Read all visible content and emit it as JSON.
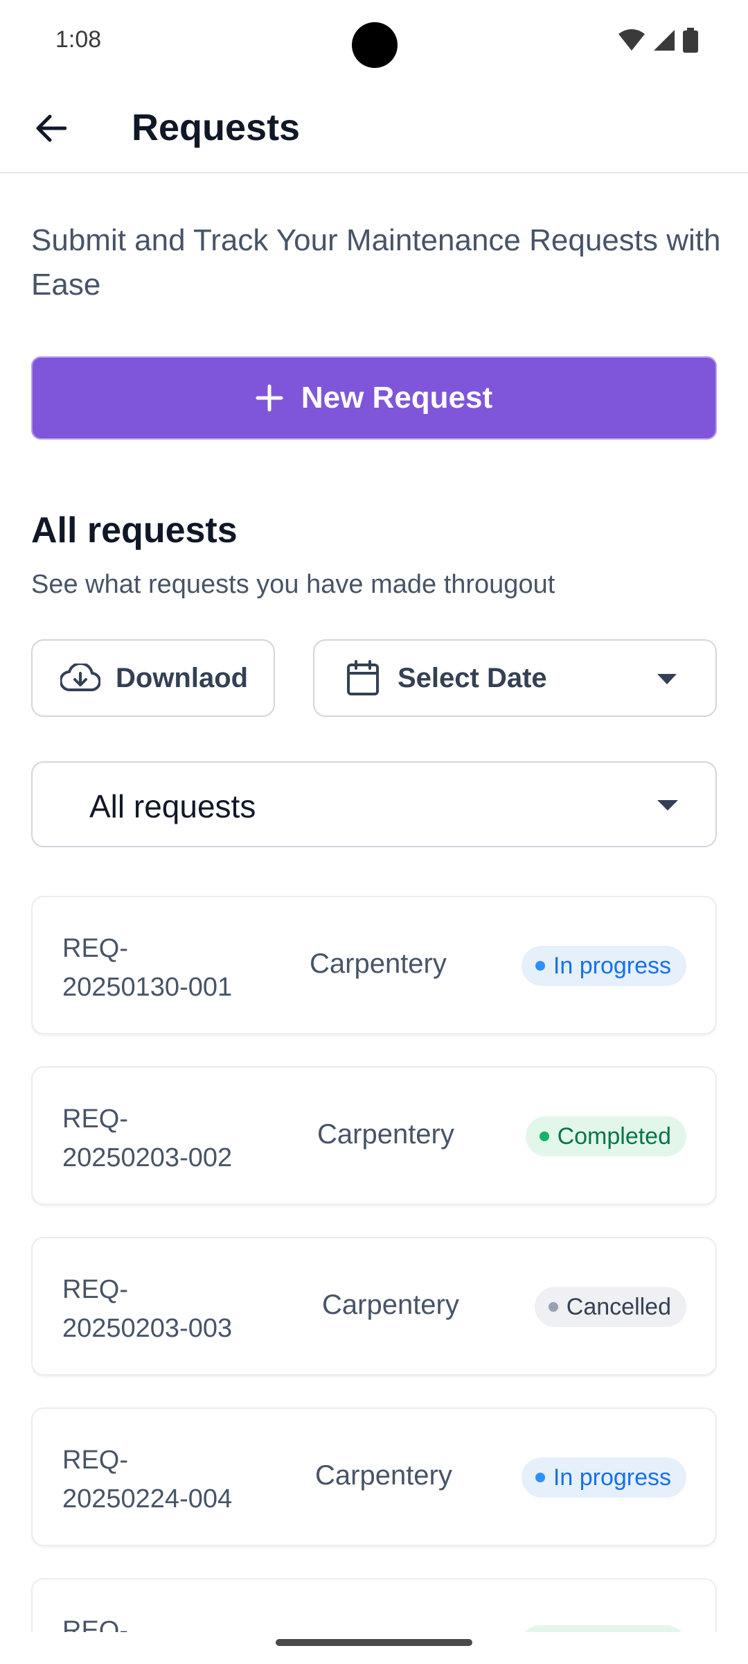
{
  "status_bar": {
    "time": "1:08"
  },
  "app_bar": {
    "title": "Requests"
  },
  "intro": {
    "subtitle": "Submit and Track Your Maintenance Requests with Ease"
  },
  "new_request": {
    "label": "New Request"
  },
  "section": {
    "title": "All requests",
    "subtitle": "See what requests you have made througout"
  },
  "toolbar": {
    "download_label": "Downlaod",
    "date_label": "Select Date"
  },
  "filter": {
    "selected": "All requests"
  },
  "requests": [
    {
      "id_prefix": "REQ-",
      "id_number": "20250130-001",
      "category": "Carpentery",
      "status": "In progress"
    },
    {
      "id_prefix": "REQ-",
      "id_number": "20250203-002",
      "category": "Carpentery",
      "status": "Completed"
    },
    {
      "id_prefix": "REQ-",
      "id_number": "20250203-003",
      "category": "Carpentery",
      "status": "Cancelled"
    },
    {
      "id_prefix": "REQ-",
      "id_number": "20250224-004",
      "category": "Carpentery",
      "status": "In progress"
    },
    {
      "id_prefix": "REQ-",
      "id_number": "",
      "category": "",
      "status": ""
    }
  ],
  "colors": {
    "accent": "#7f56d9",
    "in_progress": "#1570ef",
    "completed": "#067647",
    "cancelled": "#344054"
  }
}
